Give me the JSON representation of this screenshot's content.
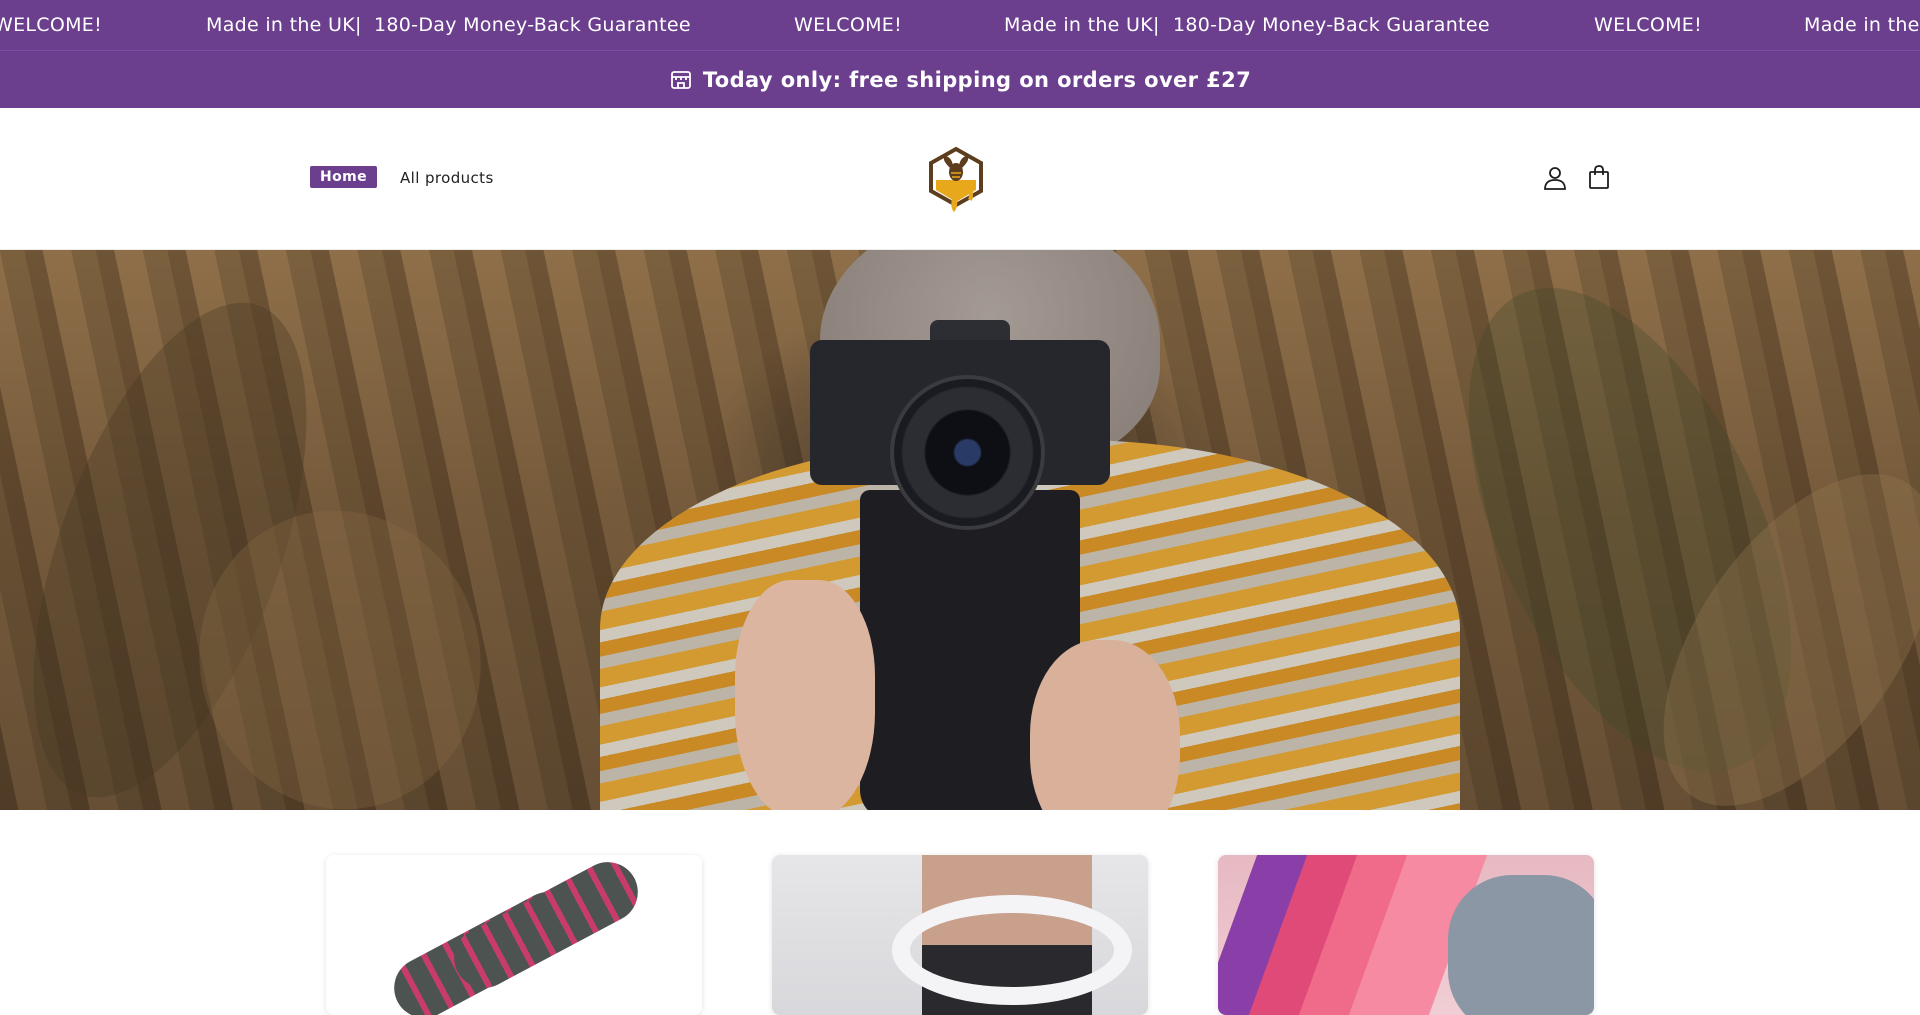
{
  "marquee": {
    "items": [
      "WELCOME!",
      "Made in the UK|",
      "180-Day Money-Back Guarantee",
      "WELCOME!",
      "Made in the UK|",
      "180-Day Money-Back Guarantee",
      "WELCOME!",
      "Made in the"
    ]
  },
  "announcement": {
    "icon": "shop-icon",
    "text": "Today only: free shipping on orders over £27"
  },
  "header": {
    "nav": [
      {
        "label": "Home",
        "active": true
      },
      {
        "label": "All products",
        "active": false
      }
    ],
    "logo": "bee-honey-logo",
    "icons": [
      "account-icon",
      "cart-icon"
    ]
  },
  "hero": {
    "image": "woman-with-camera-in-cornfield"
  },
  "products": [
    {
      "image": "jump-rope-handles"
    },
    {
      "image": "smart-weighted-hula-hoop"
    },
    {
      "image": "resistance-bands"
    }
  ],
  "colors": {
    "brand_purple": "#6b3f8e",
    "logo_amber": "#e8a81c",
    "logo_brown": "#5c3d1e"
  }
}
